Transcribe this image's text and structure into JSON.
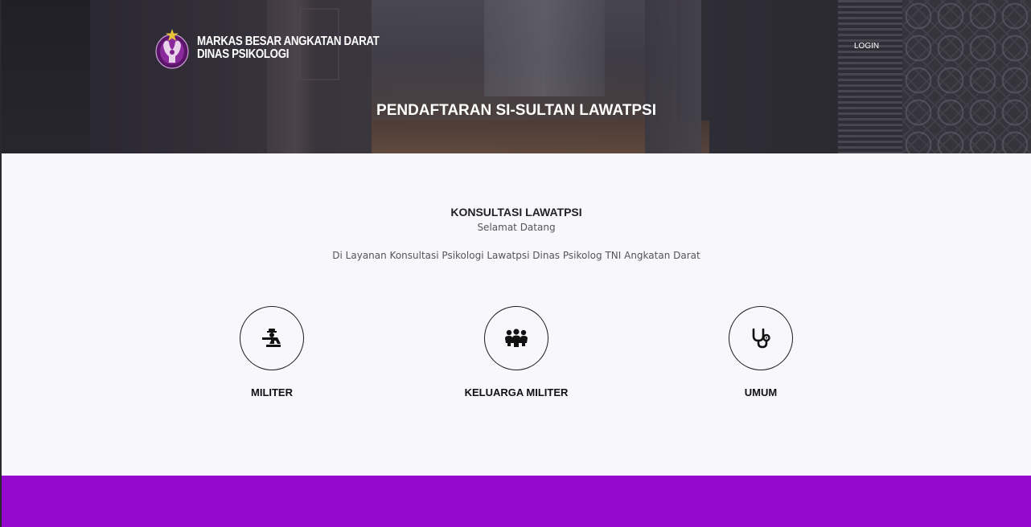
{
  "header": {
    "brand_line1": "MARKAS BESAR ANGKATAN DARAT",
    "brand_line2": "DINAS PSIKOLOGI",
    "login_label": "LOGIN",
    "hero_title": "PENDAFTARAN SI-SULTAN LAWATPSI"
  },
  "main": {
    "title": "KONSULTASI LAWATPSI",
    "subtitle": "Selamat Datang",
    "description": "Di Layanan Konsultasi Psikologi Lawatpsi Dinas Psikolog TNI Angkatan Darat",
    "options": [
      {
        "label": "MILITER",
        "icon": "soldier-icon"
      },
      {
        "label": "KELUARGA MILITER",
        "icon": "family-icon"
      },
      {
        "label": "UMUM",
        "icon": "stethoscope-icon"
      }
    ]
  },
  "colors": {
    "footer": "#9308cc",
    "emblem_purple": "#7a1f8c",
    "emblem_gold": "#e8c23a"
  }
}
